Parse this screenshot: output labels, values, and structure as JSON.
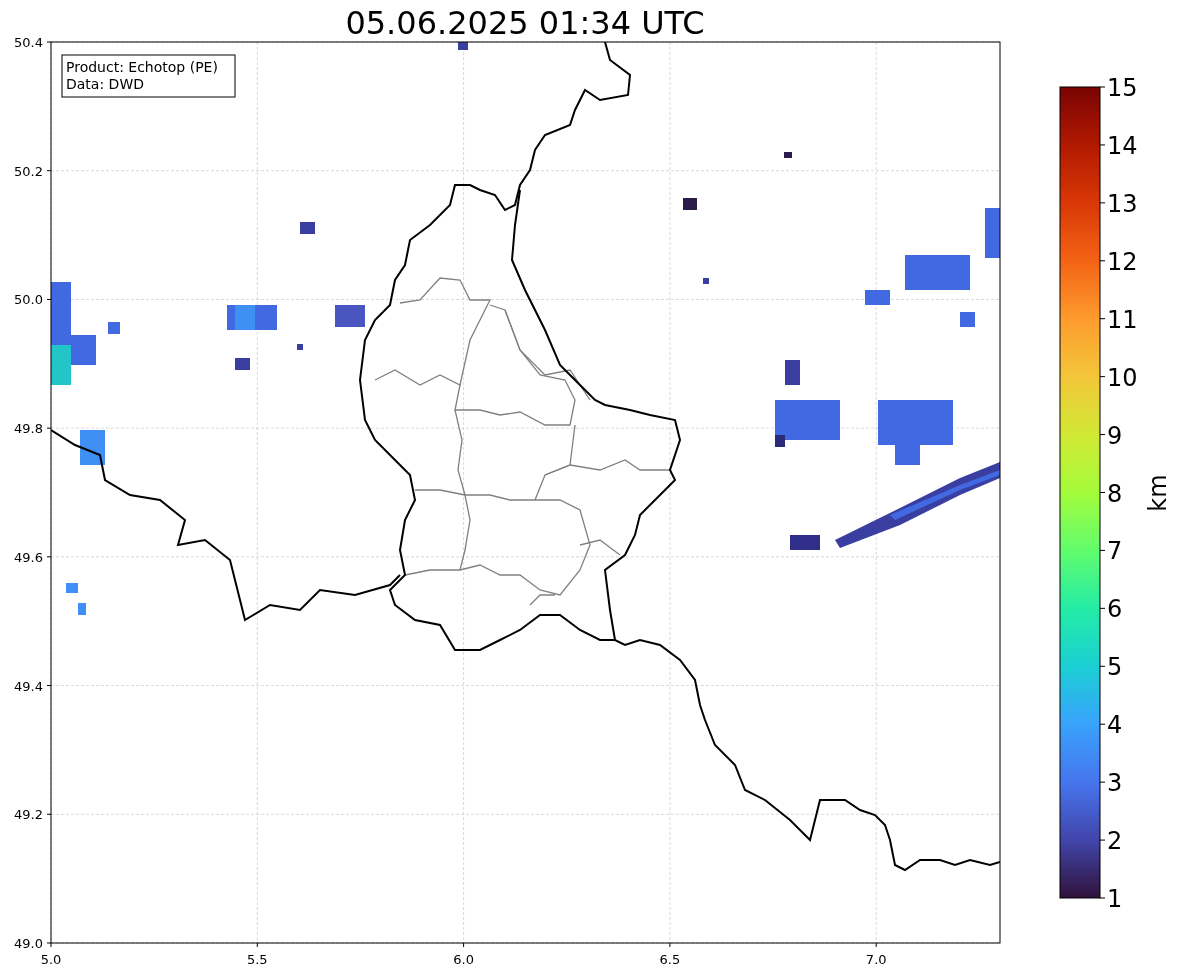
{
  "title": "05.06.2025 01:34 UTC",
  "info_box": [
    "Product: Echotop (PE)",
    "Data: DWD"
  ],
  "map": {
    "xticks": [
      "5.0",
      "5.5",
      "6.0",
      "6.5",
      "7.0"
    ],
    "yticks": [
      "50.4",
      "50.2",
      "50.0",
      "49.8",
      "49.6",
      "49.4",
      "49.2",
      "49.0"
    ]
  },
  "colorbar": {
    "ticks": [
      "15",
      "14",
      "13",
      "12",
      "11",
      "10",
      "9",
      "8",
      "7",
      "6",
      "5",
      "4",
      "3",
      "2",
      "1"
    ],
    "label": "km"
  }
}
